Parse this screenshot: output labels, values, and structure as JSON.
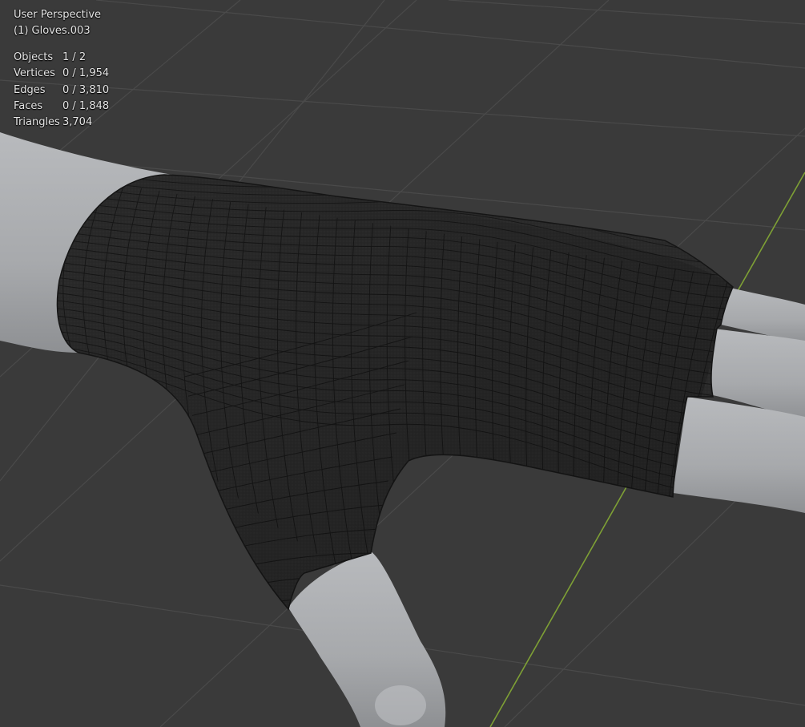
{
  "viewport": {
    "view_name": "User Perspective",
    "active_object": "(1) Gloves.003"
  },
  "stats": [
    {
      "label": "Objects",
      "value": "1 / 2"
    },
    {
      "label": "Vertices",
      "value": "0 / 1,954"
    },
    {
      "label": "Edges",
      "value": "0 / 3,810"
    },
    {
      "label": "Faces",
      "value": "0 / 1,848"
    },
    {
      "label": "Triangles",
      "value": "3,704"
    }
  ],
  "colors": {
    "background": "#3a3a3a",
    "grid_line": "#4a4a4a",
    "y_axis": "#7ea035",
    "skin": "#a9abae",
    "glove_fill": "#2b2b2b",
    "glove_wire": "#141414"
  }
}
